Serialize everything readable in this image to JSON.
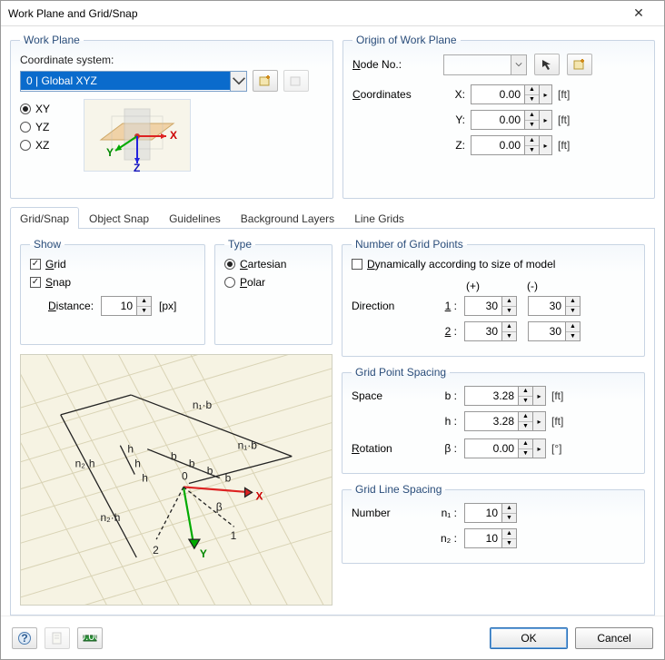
{
  "window": {
    "title": "Work Plane and Grid/Snap"
  },
  "work_plane": {
    "legend": "Work Plane",
    "cs_label": "Coordinate system:",
    "cs_value": "0 | Global XYZ",
    "radios": {
      "xy": "XY",
      "yz": "YZ",
      "xz": "XZ"
    },
    "selected": "XY"
  },
  "origin": {
    "legend": "Origin of Work Plane",
    "node_label": "Node No.:",
    "coords_label": "Coordinates",
    "axes": {
      "x": "X:",
      "y": "Y:",
      "z": "Z:"
    },
    "values": {
      "x": "0.00",
      "y": "0.00",
      "z": "0.00"
    },
    "unit": "[ft]"
  },
  "tabs": {
    "grid_snap": "Grid/Snap",
    "object_snap": "Object Snap",
    "guidelines": "Guidelines",
    "background_layers": "Background Layers",
    "line_grids": "Line Grids",
    "active": "grid_snap"
  },
  "show": {
    "legend": "Show",
    "grid": "Grid",
    "snap": "Snap",
    "grid_checked": true,
    "snap_checked": true,
    "distance_label": "Distance:",
    "distance_value": "10",
    "distance_unit": "[px]"
  },
  "type": {
    "legend": "Type",
    "cartesian": "Cartesian",
    "polar": "Polar",
    "selected": "Cartesian"
  },
  "ngp": {
    "legend": "Number of Grid Points",
    "dyn_label": "Dynamically according to size of model",
    "dyn_checked": false,
    "plus": "(+)",
    "minus": "(-)",
    "direction": "Direction",
    "d1": "1 :",
    "d2": "2 :",
    "v1p": "30",
    "v1m": "30",
    "v2p": "30",
    "v2m": "30"
  },
  "gps": {
    "legend": "Grid Point Spacing",
    "space": "Space",
    "b": "b :",
    "h": "h :",
    "bv": "3.28",
    "hv": "3.28",
    "unit": "[ft]",
    "rotation": "Rotation",
    "beta": "β :",
    "betav": "0.00",
    "beta_unit": "[°]"
  },
  "gls": {
    "legend": "Grid Line Spacing",
    "number": "Number",
    "n1": "n₁ :",
    "n2": "n₂ :",
    "n1v": "10",
    "n2v": "10"
  },
  "diagram": {
    "labels": {
      "origin": "0",
      "x": "X",
      "y": "Y",
      "one": "1",
      "two": "2",
      "n1b": "n₁·b",
      "n1bm": "n₁·b",
      "n2h": "n₂·h",
      "n2hm": "n₂·h",
      "h": "h",
      "b": "b",
      "beta": "β"
    }
  },
  "buttons": {
    "ok": "OK",
    "cancel": "Cancel"
  }
}
